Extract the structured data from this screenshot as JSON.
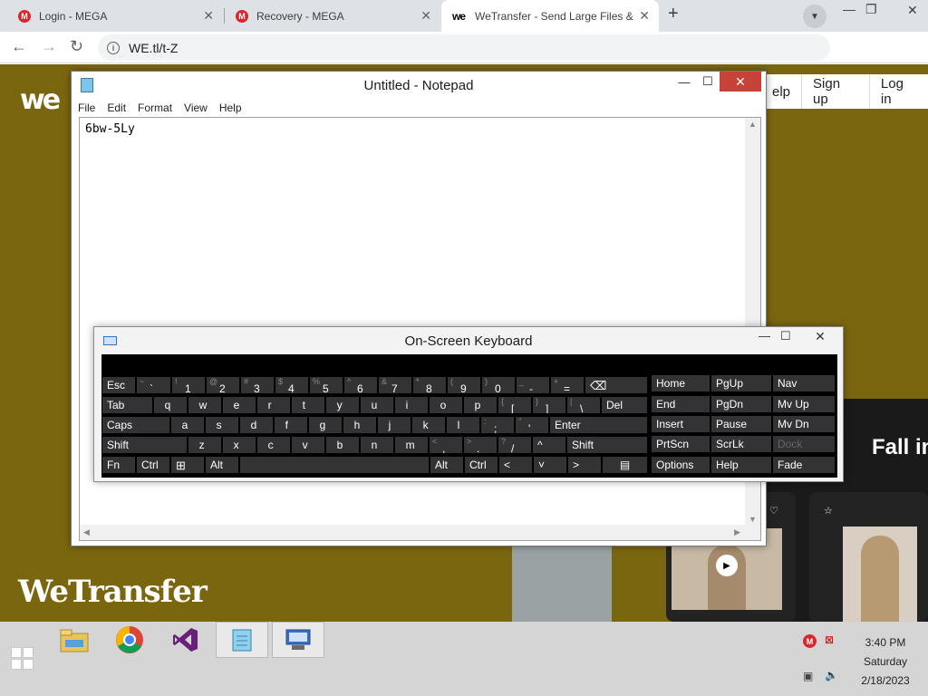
{
  "browser": {
    "tabs": [
      {
        "title": "Login - MEGA",
        "favicon": "mega-icon",
        "active": false
      },
      {
        "title": "Recovery - MEGA",
        "favicon": "mega-icon",
        "active": false
      },
      {
        "title": "WeTransfer - Send Large Files &",
        "favicon": "wetransfer-icon",
        "active": true
      }
    ],
    "url": "WE.tl/t-Z",
    "mega_glyph": "M",
    "we_glyph": "we"
  },
  "wetransfer": {
    "logo": "we",
    "nav": {
      "help": "elp",
      "sign_up": "Sign up",
      "log_in": "Log in"
    },
    "wordmark": "WeTransfer",
    "promo_heading": "Fall in"
  },
  "notepad": {
    "title": "Untitled - Notepad",
    "menu": [
      "File",
      "Edit",
      "Format",
      "View",
      "Help"
    ],
    "content": "6bw-5Ly"
  },
  "osk": {
    "title": "On-Screen Keyboard"
  },
  "taskbar": {
    "time": "3:40 PM",
    "day": "Saturday",
    "date": "2/18/2023"
  },
  "colors": {
    "wetransfer_bg": "#7b6610",
    "mega_red": "#d9272e",
    "osk_key": "#333336",
    "notepad_close": "#c7433a"
  }
}
